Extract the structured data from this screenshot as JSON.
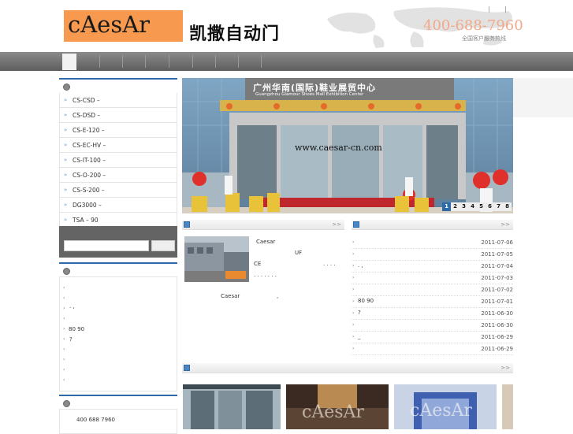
{
  "header": {
    "logo_text": "cAesAr",
    "company_name_cn": "凯撒自动门",
    "hotline": "400-688-7960",
    "hotline_sub": "全国客户服务热线"
  },
  "products": [
    {
      "label": "CS-CSD –"
    },
    {
      "label": "CS-DSD –"
    },
    {
      "label": "CS-E-120 –"
    },
    {
      "label": "CS-EC-HV –"
    },
    {
      "label": "CS-IT-100 –"
    },
    {
      "label": "CS-O-200 –"
    },
    {
      "label": "CS-S-200 –"
    },
    {
      "label": "DG3000 –"
    },
    {
      "label": "TSA –    90"
    }
  ],
  "left_news": [
    {
      "text": ""
    },
    {
      "text": ""
    },
    {
      "text": " .  ,"
    },
    {
      "text": ""
    },
    {
      "text": "80 90"
    },
    {
      "text": "        ?"
    },
    {
      "text": ""
    },
    {
      "text": ""
    },
    {
      "text": ""
    },
    {
      "text": ""
    }
  ],
  "contact": {
    "phone": "400 688 7960"
  },
  "banner": {
    "sign_cn": "广州华南(国际)鞋业展贸中心",
    "sign_en": "Guangzhou Glamour Shoes Mall Exhibition Center",
    "watermark": "www.caesar-cn.com",
    "pages": [
      "1",
      "2",
      "3",
      "4",
      "5",
      "6",
      "7",
      "8"
    ]
  },
  "about": {
    "more": ">>",
    "line1": "Caesar",
    "line2": "UF",
    "line3": "CE",
    "line4": ". . . .",
    "line5": ". . . . . . .",
    "line6": "Caesar",
    "line6b": ","
  },
  "news_list": {
    "more": ">>",
    "rows": [
      {
        "text": "",
        "date": "2011-07-06"
      },
      {
        "text": "",
        "date": "2011-07-05"
      },
      {
        "text": "  . ,",
        "date": "2011-07-04"
      },
      {
        "text": "",
        "date": "2011-07-03"
      },
      {
        "text": "",
        "date": "2011-07-02"
      },
      {
        "text": "80 90",
        "date": "2011-07-01"
      },
      {
        "text": "        ?",
        "date": "2011-06-30"
      },
      {
        "text": "",
        "date": "2011-06-30"
      },
      {
        "text": "        _",
        "date": "2011-06-29"
      },
      {
        "text": "",
        "date": "2011-06-29"
      }
    ]
  },
  "cases": {
    "more": ">>"
  },
  "colors": {
    "accent": "#2e6aa8",
    "logo_bg": "#f79a4f",
    "nav": "#6e6e6e"
  }
}
